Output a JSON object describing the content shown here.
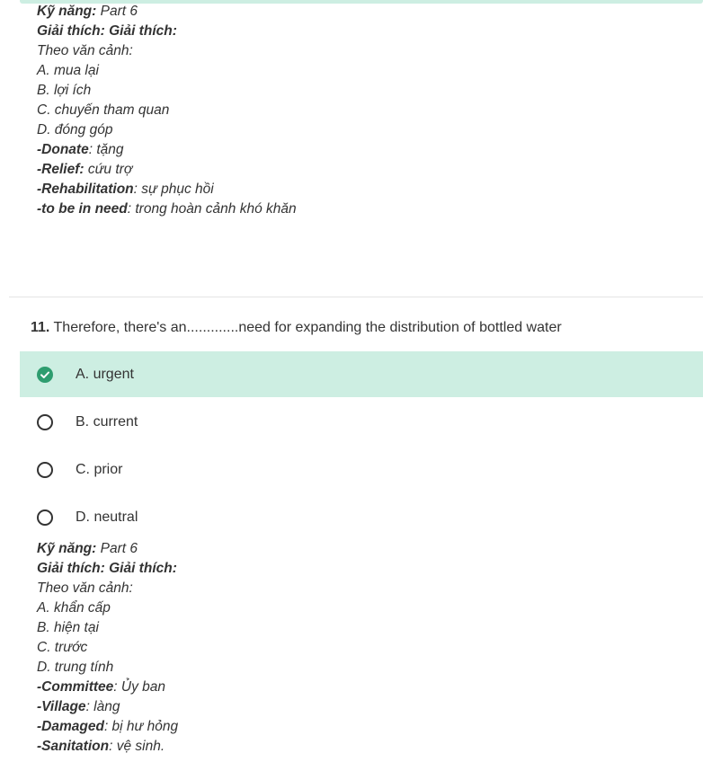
{
  "colors": {
    "selected_bg": "#cdeee2",
    "check_green": "#2e9d6f",
    "text": "#333333"
  },
  "previous_explanation": {
    "skill_label": "Kỹ năng:",
    "skill_value": " Part 6",
    "explain_label": "Giải thích: Giải thích:",
    "context": "Theo văn cảnh:",
    "choices": [
      "A. mua lại",
      "B. lợi ích",
      "C. chuyến tham quan",
      "D. đóng góp"
    ],
    "vocab": [
      {
        "term": "-Donate",
        "meaning": ": tặng"
      },
      {
        "term": "-Relief:",
        "meaning": " cứu trợ"
      },
      {
        "term": "-Rehabilitation",
        "meaning": ": sự phục hồi"
      },
      {
        "term": "-to be in need",
        "meaning": ": trong hoàn cảnh khó khăn"
      }
    ]
  },
  "question": {
    "number": "11.",
    "text": " Therefore, there's an.............need for expanding the distribution of bottled water",
    "options": [
      {
        "label": "A. urgent",
        "selected": true,
        "icon": "check-circle-icon"
      },
      {
        "label": "B. current",
        "selected": false,
        "icon": "radio-icon"
      },
      {
        "label": "C. prior",
        "selected": false,
        "icon": "radio-icon"
      },
      {
        "label": "D. neutral",
        "selected": false,
        "icon": "radio-icon"
      }
    ]
  },
  "explanation": {
    "skill_label": "Kỹ năng:",
    "skill_value": " Part 6",
    "explain_label": "Giải thích: Giải thích:",
    "context": "Theo văn cảnh:",
    "choices": [
      "A. khẩn cấp",
      "B. hiện tại",
      "C. trước",
      "D. trung tính"
    ],
    "vocab": [
      {
        "term": "-Committee",
        "meaning": ": Ủy ban"
      },
      {
        "term": "-Village",
        "meaning": ": làng"
      },
      {
        "term": "-Damaged",
        "meaning": ": bị hư hỏng"
      },
      {
        "term": "-Sanitation",
        "meaning": ": vệ sinh."
      }
    ]
  }
}
